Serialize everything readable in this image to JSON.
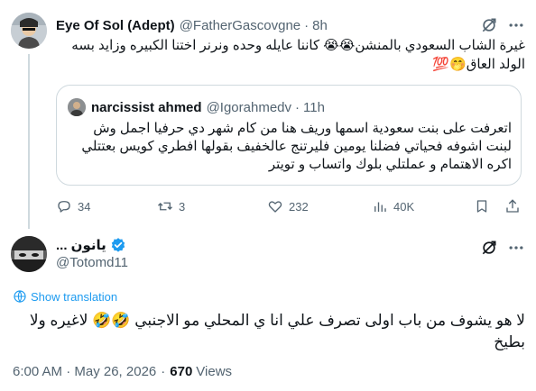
{
  "parent_tweet": {
    "author_name": "Eye Of Sol (Adept)",
    "author_handle": "@FatherGascovgne",
    "separator": "·",
    "time": "8h",
    "text": "غيرة الشاب السعودي بالمنشن😭😭 كاننا عايله وحده ونرنر اختنا الكبيره وزايد بسه الولد العاق🤭💯",
    "quoted_tweet": {
      "author_name": "narcissist ahmed",
      "author_handle": "@Igorahmedv",
      "separator": "·",
      "time": "11h",
      "text": "اتعرفت على بنت سعودية اسمها وريف هنا من كام شهر دي حرفيا اجمل وش لبنت اشوفه فحياتي فضلنا يومين فليرتنج عالخفيف بقولها افطري كويس بعتتلي اكره الاهتمام و عملتلي بلوك واتساب و تويتر"
    },
    "actions": {
      "replies": "34",
      "reposts": "3",
      "likes": "232",
      "views": "40K"
    }
  },
  "main_tweet": {
    "author_name": "... يانون",
    "author_handle": "@Totomd11",
    "show_translation": "Show translation",
    "text": "لا هو يشوف من باب اولى تصرف علي انا ي المحلي مو الاجنبي 🤣🤣 لاغيره ولا بطيخ",
    "timestamp": "6:00 AM · May 26, 2026",
    "views_count": "670",
    "views_label": "Views"
  },
  "colors": {
    "text_primary": "#0f1419",
    "text_secondary": "#536471",
    "accent_blue": "#1d9bf0",
    "border": "#cfd9de"
  },
  "icons": [
    "grok-icon",
    "more-icon",
    "reply-icon",
    "repost-icon",
    "like-icon",
    "views-icon",
    "bookmark-icon",
    "share-icon",
    "verified-badge-icon",
    "translate-icon"
  ]
}
